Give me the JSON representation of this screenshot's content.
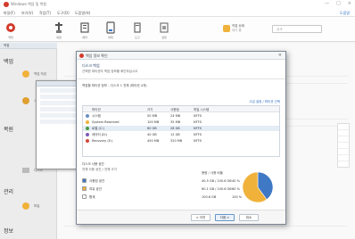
{
  "app": {
    "title": "Windows 백업 및 복원",
    "window_controls": [
      "—",
      "□",
      "×"
    ]
  },
  "menu": {
    "items": [
      "파일(F)",
      "보기(V)",
      "작업(T)",
      "도구(O)",
      "도움말(H)"
    ],
    "right_link": "도움말"
  },
  "toolbar": {
    "buttons": [
      {
        "label": "백업",
        "icon": "backup-icon"
      },
      {
        "label": "복원",
        "icon": "restore-icon"
      },
      {
        "label": "예약",
        "icon": "schedule-icon"
      },
      {
        "label": "복제",
        "icon": "clone-icon"
      },
      {
        "label": "도구",
        "icon": "tools-icon"
      },
      {
        "label": "설정",
        "icon": "settings-icon"
      }
    ],
    "status_line1": "작업 상태",
    "status_line2": "대기 중",
    "search_placeholder": "검색"
  },
  "left_panel": {
    "header": "작업",
    "sections": [
      "백업",
      "복원",
      "관리",
      "정보"
    ],
    "items": [
      "백업 작업",
      "시스템",
      "디스크",
      "파일",
      "설정"
    ]
  },
  "dialog": {
    "title": "백업 정보 확인",
    "close": "×",
    "heading": "디스크 백업",
    "subheading": "선택한 파티션의 백업 정보를 확인하십시오",
    "description": "백업할 파티션 정보 – 디스크 1 전체 (파티션 4개)",
    "link": "고급 설정 / 파티션 선택",
    "table": {
      "headers": [
        "파티션",
        "크기",
        "사용됨",
        "파일 시스템"
      ],
      "rows": [
        {
          "name": "시스템",
          "size": "50 MB",
          "used": "24 MB",
          "fs": "NTFS",
          "color": "#6b8ec7"
        },
        {
          "name": "System Reserved",
          "size": "100 MB",
          "used": "35 MB",
          "fs": "NTFS",
          "color": "#f0b23a"
        },
        {
          "name": "로컬 (C:)",
          "size": "60 GB",
          "used": "28 GB",
          "fs": "NTFS",
          "color": "#4a9a46"
        },
        {
          "name": "데이터 (D:)",
          "size": "40 GB",
          "used": "12 GB",
          "fs": "NTFS",
          "color": "#7a5bb8"
        },
        {
          "name": "Recovery (E:)",
          "size": "450 MB",
          "used": "320 MB",
          "fs": "NTFS",
          "color": "#d04a3a"
        }
      ]
    },
    "summary": {
      "title": "디스크 사용 공간",
      "subtitle": "전체 사용 공간 / 전체 크기",
      "header": "용량 / 사용 비율",
      "rows": [
        {
          "label": "사용된 공간",
          "value": "40.5 GB / 100.6 GB",
          "percent": "40 %",
          "color": "#3f78c4"
        },
        {
          "label": "여유 공간",
          "value": "60.1 GB / 100.6 GB",
          "percent": "60 %",
          "color": "#f0b23a"
        },
        {
          "label": "합계",
          "value": "100.6 GB",
          "percent": "100 %",
          "color": "#ffffff"
        }
      ]
    },
    "buttons": {
      "back": "< 이전",
      "next": "다음 >",
      "cancel": "취소"
    }
  }
}
